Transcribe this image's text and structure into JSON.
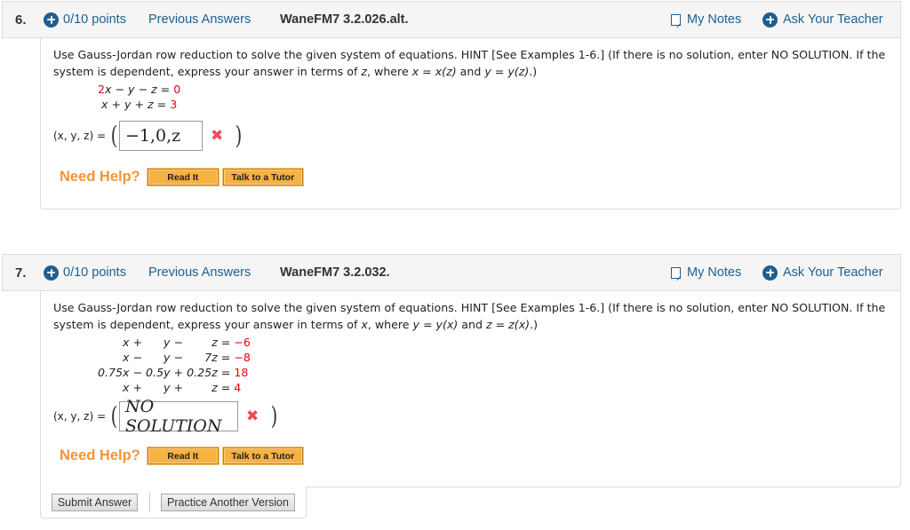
{
  "questions": [
    {
      "number": "6.",
      "points": "0/10 points",
      "previous_answers": "Previous Answers",
      "assignment_id": "WaneFM7 3.2.026.alt.",
      "my_notes": "My Notes",
      "ask_teacher": "Ask Your Teacher",
      "prompt_line1": "Use Gauss-Jordan row reduction to solve the given system of equations. HINT [See Examples 1-6.] (If there is no solution, enter NO SOLUTION. If the",
      "prompt_line2_a": "system is dependent, express your answer in terms of ",
      "prompt_var": "z",
      "prompt_line2_b": ", where ",
      "prompt_rel1": "x = x(z)",
      "prompt_and": " and ",
      "prompt_rel2": "y = y(z)",
      "prompt_end": ".)",
      "equations": [
        {
          "lhs": "2x − y − z =",
          "rhs": "0",
          "lhs_coef_red": "2",
          "lhs_rest": "x − y − z = "
        },
        {
          "lhs": " x + y + z =",
          "rhs": "3",
          "lhs_coef_red": "",
          "lhs_rest": " x + y + z = "
        }
      ],
      "answer_label": "(x, y, z) =",
      "answer_value": "−1,0,z",
      "answer_status": "incorrect",
      "need_help": "Need Help?",
      "read_it": "Read It",
      "talk_to_tutor": "Talk to a Tutor"
    },
    {
      "number": "7.",
      "points": "0/10 points",
      "previous_answers": "Previous Answers",
      "assignment_id": "WaneFM7 3.2.032.",
      "my_notes": "My Notes",
      "ask_teacher": "Ask Your Teacher",
      "prompt_line1": "Use Gauss-Jordan row reduction to solve the given system of equations. HINT [See Examples 1-6.] (If there is no solution, enter NO SOLUTION. If the",
      "prompt_line2_a": "system is dependent, express your answer in terms of ",
      "prompt_var": "x",
      "prompt_line2_b": ", where ",
      "prompt_rel1": "y = y(x)",
      "prompt_and": " and ",
      "prompt_rel2": "z = z(x)",
      "prompt_end": ".)",
      "equations": [
        {
          "lhs_rest": "       x +      y −        z = ",
          "rhs": "−6"
        },
        {
          "lhs_rest": "       x −      y −      7z = ",
          "rhs": "−8"
        },
        {
          "lhs_rest": "0.75x − 0.5y + 0.25z = ",
          "rhs": "18"
        },
        {
          "lhs_rest": "       x +      y +        z = ",
          "rhs": "4"
        }
      ],
      "answer_label": "(x, y, z) =",
      "answer_value": "NO SOLUTION",
      "answer_status": "incorrect",
      "need_help": "Need Help?",
      "read_it": "Read It",
      "talk_to_tutor": "Talk to a Tutor"
    }
  ],
  "footer": {
    "submit_answer": "Submit Answer",
    "practice_another": "Practice Another Version"
  },
  "icons": {
    "points": "plus-circle-icon",
    "my_notes": "notes-icon",
    "ask_teacher": "plus-circle-icon",
    "wrong": "✖"
  },
  "colors": {
    "link_blue": "#1f5f8f",
    "answer_red": "#e8000f",
    "help_orange": "#f39435",
    "button_orange": "#f8b241",
    "wrong_x": "#ee4a5a"
  }
}
